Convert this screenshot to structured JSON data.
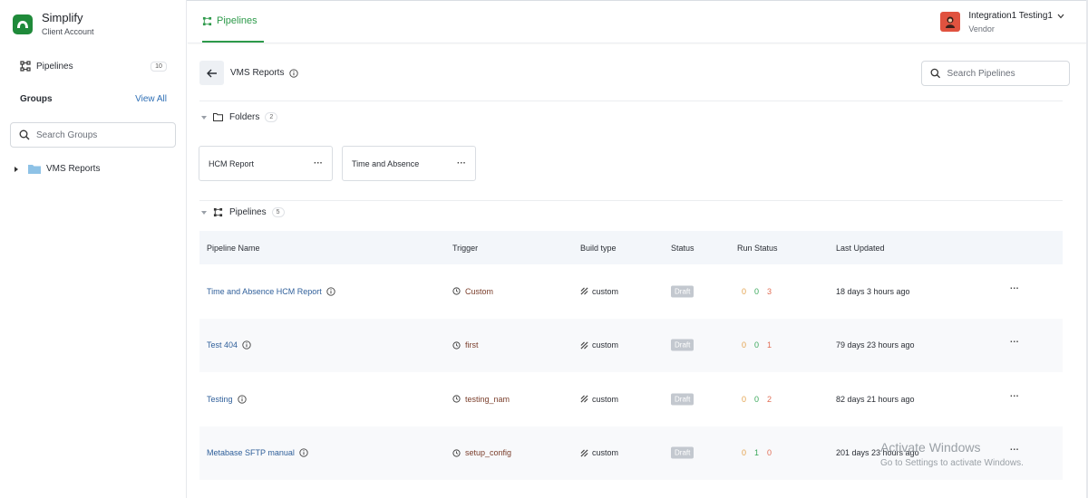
{
  "brand": {
    "name": "Simplify",
    "subtitle": "Client Account"
  },
  "sidebar": {
    "pipelines_label": "Pipelines",
    "pipelines_count": "10",
    "groups_label": "Groups",
    "view_all": "View All",
    "search_placeholder": "Search Groups",
    "tree": [
      {
        "label": "VMS Reports"
      }
    ]
  },
  "topbar": {
    "tab_label": "Pipelines",
    "user_name": "Integration1 Testing1",
    "user_role": "Vendor"
  },
  "main": {
    "title": "VMS Reports",
    "search_placeholder": "Search Pipelines",
    "folders": {
      "label": "Folders",
      "count": "2",
      "items": [
        {
          "label": "HCM Report"
        },
        {
          "label": "Time and Absence"
        }
      ]
    },
    "pipelines": {
      "label": "Pipelines",
      "count": "5",
      "columns": [
        "Pipeline Name",
        "Trigger",
        "Build type",
        "Status",
        "Run Status",
        "Last Updated"
      ],
      "rows": [
        {
          "name": "Time and Absence HCM Report",
          "trigger": "Custom",
          "build": "custom",
          "status": "Draft",
          "run": [
            "0",
            "0",
            "3"
          ],
          "updated": "18 days 3 hours ago"
        },
        {
          "name": "Test 404",
          "trigger": "first",
          "build": "custom",
          "status": "Draft",
          "run": [
            "0",
            "0",
            "1"
          ],
          "updated": "79 days 23 hours ago"
        },
        {
          "name": "Testing",
          "trigger": "testing_nam",
          "build": "custom",
          "status": "Draft",
          "run": [
            "0",
            "0",
            "2"
          ],
          "updated": "82 days 21 hours ago"
        },
        {
          "name": "Metabase SFTP manual",
          "trigger": "setup_config",
          "build": "custom",
          "status": "Draft",
          "run": [
            "0",
            "1",
            "0"
          ],
          "updated": "201 days 23 hours ago"
        }
      ]
    }
  },
  "watermark": {
    "title": "Activate Windows",
    "subtitle": "Go to Settings to activate Windows."
  },
  "colors": {
    "accent": "#2d9a4a",
    "link": "#2f5f9a",
    "badge": "#c3c8cf"
  }
}
